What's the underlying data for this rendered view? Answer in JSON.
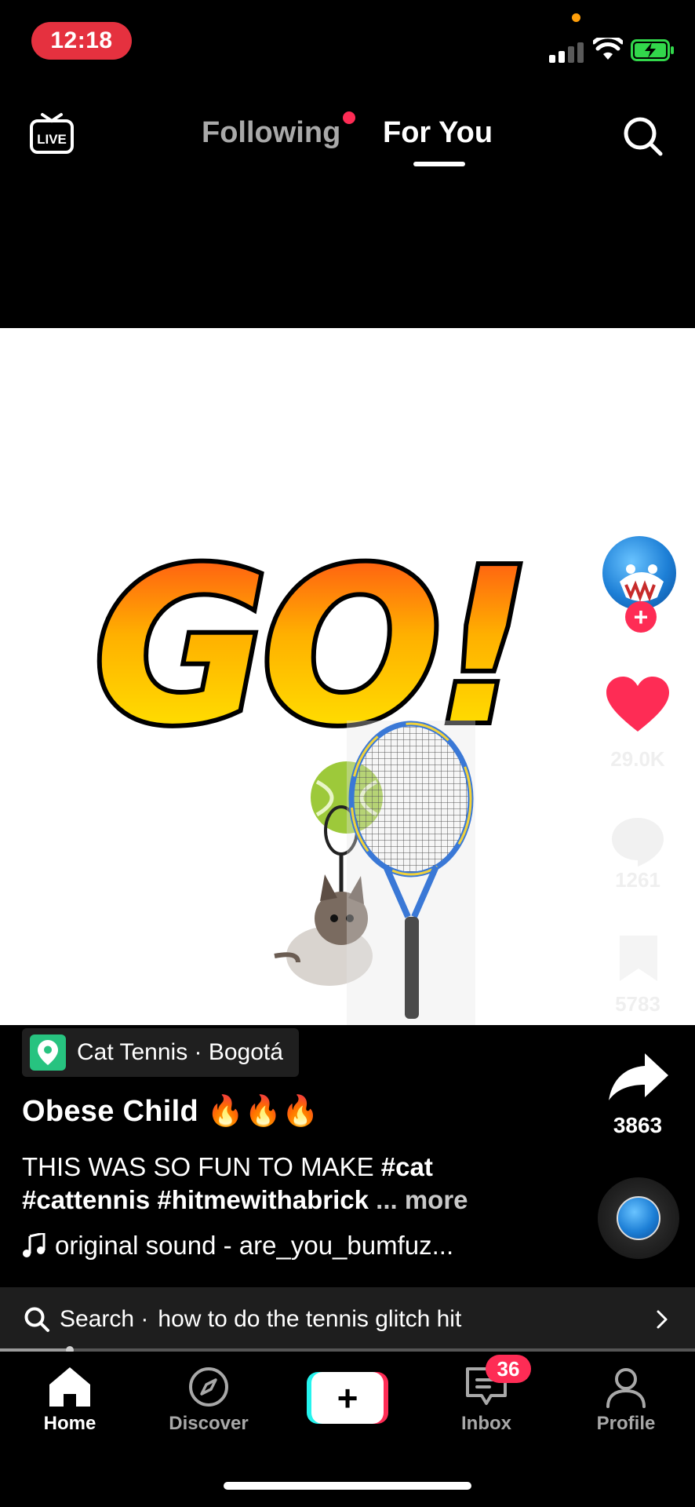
{
  "status_bar": {
    "time": "12:18"
  },
  "top_nav": {
    "live_icon": "live-tv-icon",
    "tabs": [
      {
        "label": "Following",
        "active": false,
        "has_dot": true
      },
      {
        "label": "For You",
        "active": true
      }
    ],
    "search_icon": "search-icon"
  },
  "video": {
    "content_text": "GO!"
  },
  "creator": {
    "avatar_icon": "avatar",
    "follow_icon": "plus-icon"
  },
  "actions": {
    "likes": "29.0K",
    "comments": "1261",
    "bookmarks": "5783",
    "shares": "3863"
  },
  "post": {
    "location_icon": "location-pin-icon",
    "location": "Cat Tennis · Bogotá",
    "username": "Obese  Child  🔥🔥🔥",
    "caption_text": "THIS WAS SO FUN TO MAKE ",
    "hashtags": [
      "#cat",
      "#cattennis",
      "#hitmewithabrick"
    ],
    "more_label": "... more",
    "sound": "original sound - are_you_bumfuz..."
  },
  "search_suggestion": {
    "prefix": "Search ·",
    "query": "how to do the tennis glitch hit"
  },
  "playback": {
    "progress": 0.1
  },
  "colors": {
    "accent": "#fe2c55",
    "cyan": "#25f4ee",
    "location_green": "#27c380",
    "status_red": "#e5313f"
  },
  "bottom_nav": {
    "items": [
      {
        "label": "Home",
        "icon": "home-icon",
        "active": true
      },
      {
        "label": "Discover",
        "icon": "compass-icon"
      },
      {
        "label": "",
        "icon": "plus-icon"
      },
      {
        "label": "Inbox",
        "icon": "inbox-icon",
        "badge": "36"
      },
      {
        "label": "Profile",
        "icon": "profile-icon"
      }
    ]
  }
}
